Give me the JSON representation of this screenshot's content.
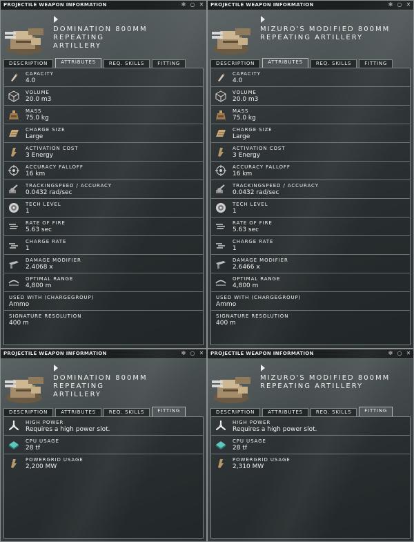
{
  "windows": [
    {
      "title": "PROJECTILE WEAPON INFORMATION",
      "name_line1": "DOMINATION 800MM REPEATING",
      "name_line2": "ARTILLERY",
      "tabs": [
        "DESCRIPTION",
        "ATTRIBUTES",
        "REQ. SKILLS",
        "FITTING"
      ],
      "active_tab": "ATTRIBUTES",
      "rows": [
        {
          "icon": "capacity-icon",
          "label": "CAPACITY",
          "value": "4.0"
        },
        {
          "icon": "volume-icon",
          "label": "VOLUME",
          "value": "20.0 m3"
        },
        {
          "icon": "mass-icon",
          "label": "MASS",
          "value": "75.0 kg"
        },
        {
          "icon": "charge-size-icon",
          "label": "CHARGE SIZE",
          "value": "Large"
        },
        {
          "icon": "activation-cost-icon",
          "label": "ACTIVATION COST",
          "value": "3 Energy"
        },
        {
          "icon": "accuracy-falloff-icon",
          "label": "ACCURACY FALLOFF",
          "value": "16 km"
        },
        {
          "icon": "tracking-speed-icon",
          "label": "TRACKINGSPEED / ACCURACY",
          "value": "0.0432 rad/sec"
        },
        {
          "icon": "tech-level-icon",
          "label": "TECH LEVEL",
          "value": "1"
        },
        {
          "icon": "rate-of-fire-icon",
          "label": "RATE OF FIRE",
          "value": "5.63 sec"
        },
        {
          "icon": "charge-rate-icon",
          "label": "CHARGE RATE",
          "value": "1"
        },
        {
          "icon": "damage-modifier-icon",
          "label": "DAMAGE MODIFIER",
          "value": "2.4068 x"
        },
        {
          "icon": "optimal-range-icon",
          "label": "OPTIMAL RANGE",
          "value": "4,800 m"
        },
        {
          "icon": "",
          "label": "USED WITH (CHARGEGROUP)",
          "value": "Ammo"
        },
        {
          "icon": "",
          "label": "SIGNATURE RESOLUTION",
          "value": "400 m"
        }
      ]
    },
    {
      "title": "PROJECTILE WEAPON INFORMATION",
      "name_line1": "MIZURO'S MODIFIED 800MM",
      "name_line2": "REPEATING ARTILLERY",
      "tabs": [
        "DESCRIPTION",
        "ATTRIBUTES",
        "REQ. SKILLS",
        "FITTING"
      ],
      "active_tab": "ATTRIBUTES",
      "rows": [
        {
          "icon": "capacity-icon",
          "label": "CAPACITY",
          "value": "4.0"
        },
        {
          "icon": "volume-icon",
          "label": "VOLUME",
          "value": "20.0 m3"
        },
        {
          "icon": "mass-icon",
          "label": "MASS",
          "value": "75.0 kg"
        },
        {
          "icon": "charge-size-icon",
          "label": "CHARGE SIZE",
          "value": "Large"
        },
        {
          "icon": "activation-cost-icon",
          "label": "ACTIVATION COST",
          "value": "3 Energy"
        },
        {
          "icon": "accuracy-falloff-icon",
          "label": "ACCURACY FALLOFF",
          "value": "16 km"
        },
        {
          "icon": "tracking-speed-icon",
          "label": "TRACKINGSPEED / ACCURACY",
          "value": "0.0432 rad/sec"
        },
        {
          "icon": "tech-level-icon",
          "label": "TECH LEVEL",
          "value": "1"
        },
        {
          "icon": "rate-of-fire-icon",
          "label": "RATE OF FIRE",
          "value": "5.63 sec"
        },
        {
          "icon": "charge-rate-icon",
          "label": "CHARGE RATE",
          "value": "1"
        },
        {
          "icon": "damage-modifier-icon",
          "label": "DAMAGE MODIFIER",
          "value": "2.6466 x"
        },
        {
          "icon": "optimal-range-icon",
          "label": "OPTIMAL RANGE",
          "value": "4,800 m"
        },
        {
          "icon": "",
          "label": "USED WITH (CHARGEGROUP)",
          "value": "Ammo"
        },
        {
          "icon": "",
          "label": "SIGNATURE RESOLUTION",
          "value": "400 m"
        }
      ]
    },
    {
      "title": "PROJECTILE WEAPON INFORMATION",
      "name_line1": "DOMINATION 800MM REPEATING",
      "name_line2": "ARTILLERY",
      "tabs": [
        "DESCRIPTION",
        "ATTRIBUTES",
        "REQ. SKILLS",
        "FITTING"
      ],
      "active_tab": "FITTING",
      "rows": [
        {
          "icon": "high-power-icon",
          "label": "HIGH POWER",
          "value": "Requires a high power slot."
        },
        {
          "icon": "cpu-usage-icon",
          "label": "CPU USAGE",
          "value": "28 tf"
        },
        {
          "icon": "powergrid-usage-icon",
          "label": "POWERGRID USAGE",
          "value": "2,200 MW"
        }
      ]
    },
    {
      "title": "PROJECTILE WEAPON INFORMATION",
      "name_line1": "MIZURO'S MODIFIED 800MM",
      "name_line2": "REPEATING ARTILLERY",
      "tabs": [
        "DESCRIPTION",
        "ATTRIBUTES",
        "REQ. SKILLS",
        "FITTING"
      ],
      "active_tab": "FITTING",
      "rows": [
        {
          "icon": "high-power-icon",
          "label": "HIGH POWER",
          "value": "Requires a high power slot."
        },
        {
          "icon": "cpu-usage-icon",
          "label": "CPU USAGE",
          "value": "28 tf"
        },
        {
          "icon": "powergrid-usage-icon",
          "label": "POWERGRID USAGE",
          "value": "2,310 MW"
        }
      ]
    }
  ],
  "titlebar_icons": [
    "settings-icon",
    "minimize-icon",
    "close-icon"
  ],
  "colors": {
    "accent": "#b8bdbe",
    "text": "#f0f0f0",
    "panel_border": "#7d8486"
  }
}
